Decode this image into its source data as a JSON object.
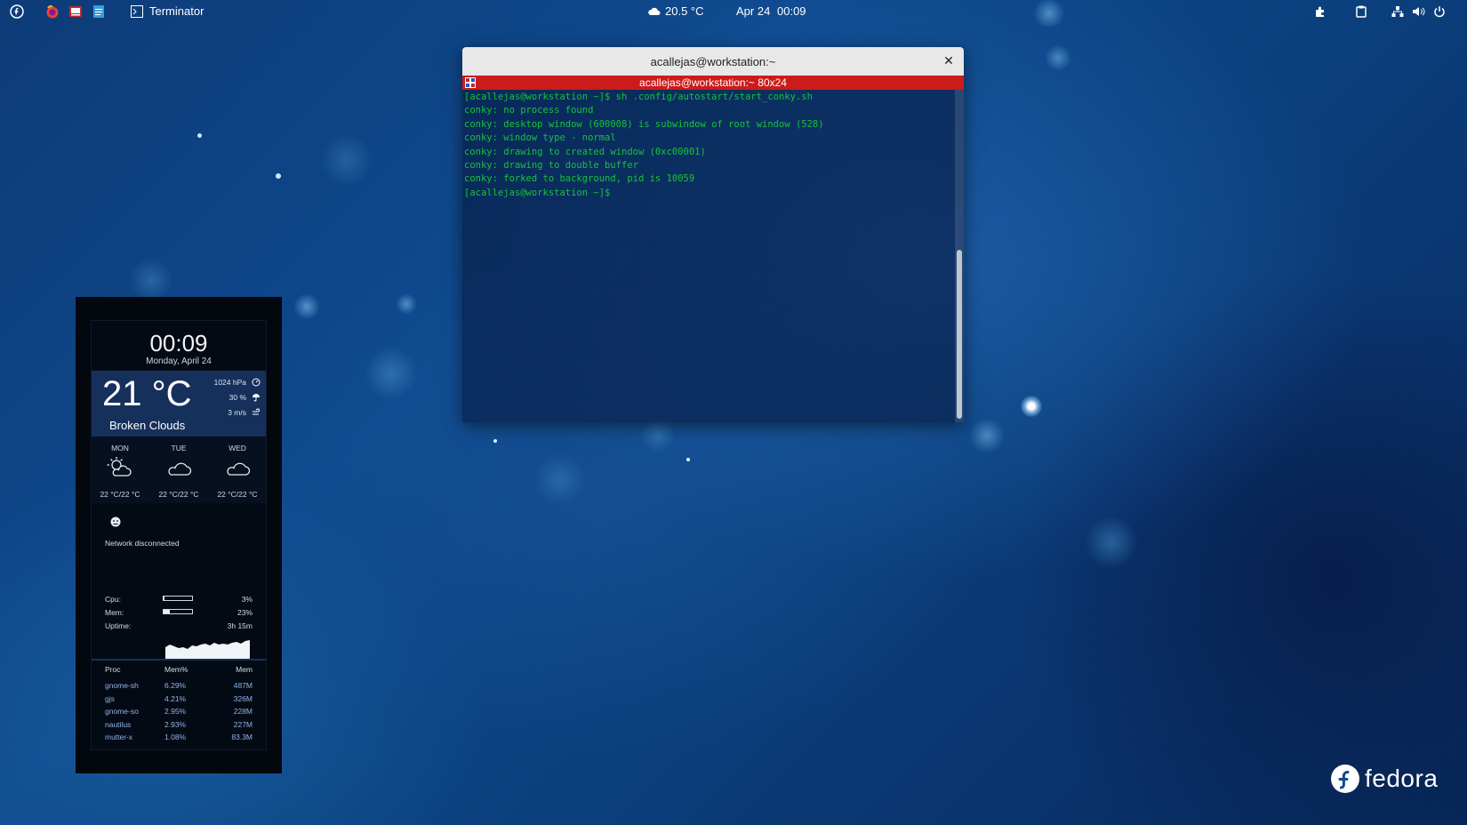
{
  "topbar": {
    "app_name": "Terminator",
    "weather": "20.5 °C",
    "date": "Apr 24",
    "time": "00:09",
    "left_icons": [
      "fedora-logo-icon",
      "firefox-icon",
      "screenshot-app-icon",
      "text-editor-icon",
      "terminal-icon"
    ],
    "right_icons": [
      "extensions-icon",
      "clipboard-icon",
      "network-icon",
      "volume-icon",
      "power-icon"
    ]
  },
  "terminal": {
    "window_title": "acallejas@workstation:~",
    "tab_title": "acallejas@workstation:~ 80x24",
    "lines": [
      "[acallejas@workstation ~]$ sh .config/autostart/start_conky.sh",
      "conky: no process found",
      "conky: desktop window (600008) is subwindow of root window (528)",
      "conky: window type - normal",
      "conky: drawing to created window (0xc00001)",
      "conky: drawing to double buffer",
      "conky: forked to background, pid is 10059",
      "[acallejas@workstation ~]$ "
    ],
    "text_color": "#19c23a",
    "tab_color": "#cc1b1b"
  },
  "conky": {
    "clock": "00:09",
    "date": "Monday, April 24",
    "temperature": "21 °C",
    "condition": "Broken Clouds",
    "pressure": "1024 hPa",
    "humidity": "30 %",
    "wind": "3 m/s",
    "forecast": [
      {
        "day": "MON",
        "range": "22 °C/22 °C",
        "icon": "partly-cloudy-icon"
      },
      {
        "day": "TUE",
        "range": "22 °C/22 °C",
        "icon": "cloud-icon"
      },
      {
        "day": "WED",
        "range": "22 °C/22 °C",
        "icon": "cloud-icon"
      }
    ],
    "network": "Network disconnected",
    "cpu_label": "Cpu:",
    "cpu_value": "3%",
    "cpu_fraction": 0.03,
    "mem_label": "Mem:",
    "mem_value": "23%",
    "mem_fraction": 0.23,
    "uptime_label": "Uptime:",
    "uptime_value": "3h 15m",
    "proc_headers": [
      "Proc",
      "Mem%",
      "Mem"
    ],
    "processes": [
      {
        "name": "gnome-sh",
        "pct": "6.29%",
        "mem": "487M"
      },
      {
        "name": "gjs",
        "pct": "4.21%",
        "mem": "326M"
      },
      {
        "name": "gnome-so",
        "pct": "2.95%",
        "mem": "228M"
      },
      {
        "name": "nautilus",
        "pct": "2.93%",
        "mem": "227M"
      },
      {
        "name": "mutter-x",
        "pct": "1.08%",
        "mem": "83.3M"
      }
    ],
    "accent": "#16305c"
  },
  "desktop": {
    "brand": "fedora"
  }
}
